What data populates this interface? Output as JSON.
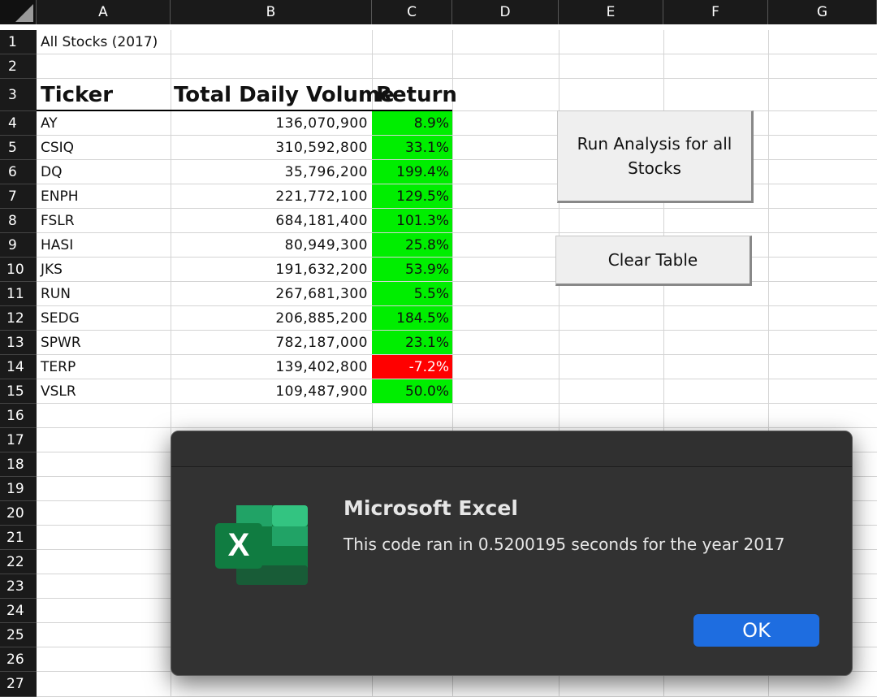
{
  "spreadsheet": {
    "columns": [
      "A",
      "B",
      "C",
      "D",
      "E",
      "F",
      "G"
    ],
    "rows": [
      "1",
      "2",
      "3",
      "4",
      "5",
      "6",
      "7",
      "8",
      "9",
      "10",
      "11",
      "12",
      "13",
      "14",
      "15",
      "16",
      "17",
      "18",
      "19",
      "20",
      "21",
      "22",
      "23",
      "24",
      "25",
      "26",
      "27"
    ],
    "title_cell": "All Stocks (2017)",
    "headers": {
      "ticker": "Ticker",
      "volume": "Total Daily Volume",
      "return": "Return"
    },
    "table": [
      {
        "ticker": "AY",
        "volume": "136,070,900",
        "return": "8.9%",
        "positive": true
      },
      {
        "ticker": "CSIQ",
        "volume": "310,592,800",
        "return": "33.1%",
        "positive": true
      },
      {
        "ticker": "DQ",
        "volume": "35,796,200",
        "return": "199.4%",
        "positive": true
      },
      {
        "ticker": "ENPH",
        "volume": "221,772,100",
        "return": "129.5%",
        "positive": true
      },
      {
        "ticker": "FSLR",
        "volume": "684,181,400",
        "return": "101.3%",
        "positive": true
      },
      {
        "ticker": "HASI",
        "volume": "80,949,300",
        "return": "25.8%",
        "positive": true
      },
      {
        "ticker": "JKS",
        "volume": "191,632,200",
        "return": "53.9%",
        "positive": true
      },
      {
        "ticker": "RUN",
        "volume": "267,681,300",
        "return": "5.5%",
        "positive": true
      },
      {
        "ticker": "SEDG",
        "volume": "206,885,200",
        "return": "184.5%",
        "positive": true
      },
      {
        "ticker": "SPWR",
        "volume": "782,187,000",
        "return": "23.1%",
        "positive": true
      },
      {
        "ticker": "TERP",
        "volume": "139,402,800",
        "return": "-7.2%",
        "positive": false
      },
      {
        "ticker": "VSLR",
        "volume": "109,487,900",
        "return": "50.0%",
        "positive": true
      }
    ],
    "colors": {
      "positive": "#00ee00",
      "negative": "#ff0000"
    }
  },
  "buttons": {
    "run_analysis_line1": "Run Analysis for all",
    "run_analysis_line2": "Stocks",
    "clear_table": "Clear Table"
  },
  "dialog": {
    "title": "Microsoft Excel",
    "message": "This code ran in 0.5200195 seconds for the year 2017",
    "ok_label": "OK",
    "icon": "excel-logo-icon"
  }
}
